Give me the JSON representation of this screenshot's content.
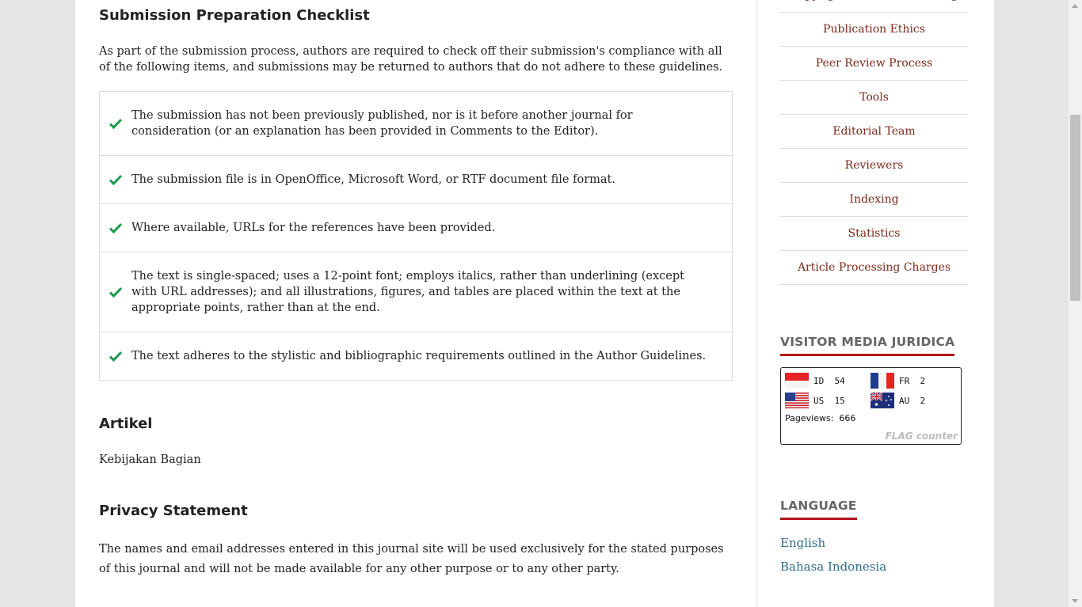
{
  "checklist_section": {
    "title": "Submission Preparation Checklist",
    "intro": "As part of the submission process, authors are required to check off their submission's compliance with all of the following items, and submissions may be returned to authors that do not adhere to these guidelines.",
    "items": [
      "The submission has not been previously published, nor is it before another journal for consideration (or an explanation has been provided in Comments to the Editor).",
      "The submission file is in OpenOffice, Microsoft Word, or RTF document file format.",
      "Where available, URLs for the references have been provided.",
      "The text is single-spaced; uses a 12-point font; employs italics, rather than underlining (except with URL addresses); and all illustrations, figures, and tables are placed within the text at the appropriate points, rather than at the end.",
      "The text adheres to the stylistic and bibliographic requirements outlined in the Author Guidelines."
    ]
  },
  "artikel_section": {
    "title": "Artikel",
    "text": "Kebijakan Bagian"
  },
  "privacy_section": {
    "title": "Privacy Statement",
    "text": "The names and email addresses entered in this journal site will be used exclusively for the stated purposes of this journal and will not be made available for any other purpose or to any other party."
  },
  "sidebar": {
    "nav": [
      "Copyright Notice & Licensing",
      "Publication Ethics",
      "Peer Review Process",
      "Tools",
      "Editorial Team",
      "Reviewers",
      "Indexing",
      "Statistics",
      "Article Processing Charges"
    ],
    "visitor_title": "VISITOR MEDIA JURIDICA",
    "flag_counter": {
      "entries": [
        {
          "code": "ID",
          "count": "54",
          "flag": "indonesia-flag"
        },
        {
          "code": "FR",
          "count": "2",
          "flag": "france-flag"
        },
        {
          "code": "US",
          "count": "15",
          "flag": "usa-flag"
        },
        {
          "code": "AU",
          "count": "2",
          "flag": "australia-flag"
        }
      ],
      "pageviews_label": "Pageviews:",
      "pageviews_value": "666",
      "logo_text": "FLAG counter"
    },
    "language_title": "LANGUAGE",
    "languages": [
      "English",
      "Bahasa Indonesia"
    ]
  },
  "colors": {
    "accent_red": "#b3161d",
    "check_green": "#1a9c4b",
    "nav_link": "#7a2a1a",
    "lang_link": "#2f6b8a"
  }
}
